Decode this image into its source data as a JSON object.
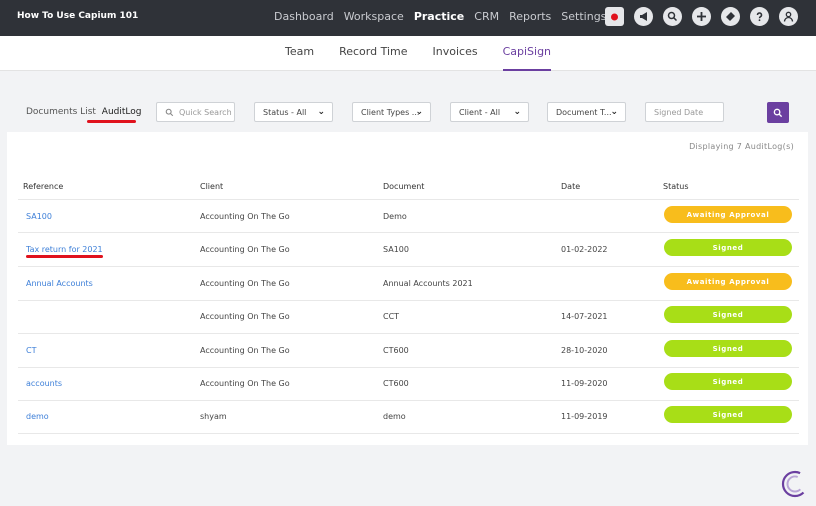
{
  "header": {
    "app_title": "How To Use Capium 101",
    "nav": [
      "Dashboard",
      "Workspace",
      "Practice",
      "CRM",
      "Reports",
      "Settings"
    ],
    "active_nav": "Practice"
  },
  "subnav": {
    "tabs": [
      "Team",
      "Record Time",
      "Invoices",
      "CapiSign"
    ],
    "active": "CapiSign"
  },
  "filters": {
    "documents_list": "Documents List",
    "auditlog": "AuditLog",
    "quick_search": "Quick Search",
    "status": "Status - All",
    "client_types": "Client Types ...",
    "client": "Client - All",
    "document_type": "Document T...",
    "signed_date": "Signed Date"
  },
  "table": {
    "displaying": "Displaying 7 AuditLog(s)",
    "headers": [
      "Reference",
      "Client",
      "Document",
      "Date",
      "Status"
    ],
    "rows": [
      {
        "reference": "SA100",
        "client": "Accounting On The Go",
        "document": "Demo",
        "date": "",
        "status": "Awaiting Approval"
      },
      {
        "reference": "Tax return for 2021",
        "client": "Accounting On The Go",
        "document": "SA100",
        "date": "01-02-2022",
        "status": "Signed"
      },
      {
        "reference": "Annual Accounts",
        "client": "Accounting On The Go",
        "document": "Annual Accounts 2021",
        "date": "",
        "status": "Awaiting Approval"
      },
      {
        "reference": "",
        "client": "Accounting On The Go",
        "document": "CCT",
        "date": "14-07-2021",
        "status": "Signed"
      },
      {
        "reference": "CT",
        "client": "Accounting On The Go",
        "document": "CT600",
        "date": "28-10-2020",
        "status": "Signed"
      },
      {
        "reference": "accounts",
        "client": "Accounting On The Go",
        "document": "CT600",
        "date": "11-09-2020",
        "status": "Signed"
      },
      {
        "reference": "demo",
        "client": "shyam",
        "document": "demo",
        "date": "11-09-2019",
        "status": "Signed"
      }
    ]
  },
  "colors": {
    "awaiting": "#f8bd1c",
    "signed": "#a8de17",
    "accent": "#6b3fa0",
    "link": "#3d7fd8"
  }
}
